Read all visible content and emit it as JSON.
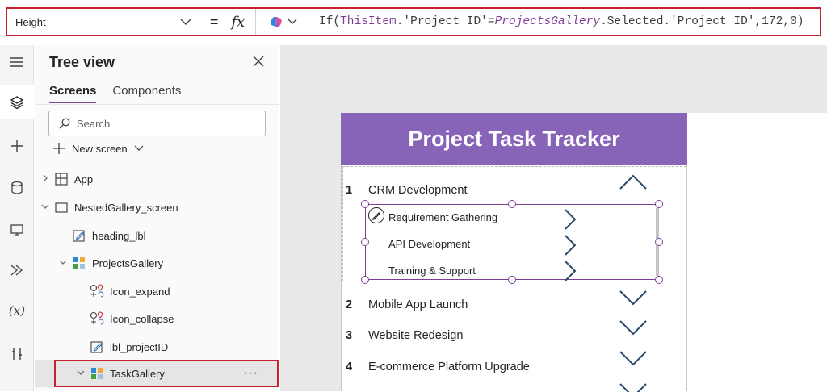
{
  "formula_bar": {
    "property": "Height",
    "equals": "=",
    "fx": "fx",
    "formula_parts": {
      "f1": "If(",
      "f2": "ThisItem",
      "f3": ".'Project ID'=",
      "f4": "ProjectsGallery",
      "f5": ".Selected.'Project ID',172,0)"
    }
  },
  "tree": {
    "title": "Tree view",
    "tabs": [
      "Screens",
      "Components"
    ],
    "search_placeholder": "Search",
    "new_screen": "New screen",
    "items": [
      {
        "label": "App"
      },
      {
        "label": "NestedGallery_screen"
      },
      {
        "label": "heading_lbl"
      },
      {
        "label": "ProjectsGallery"
      },
      {
        "label": "Icon_expand"
      },
      {
        "label": "Icon_collapse"
      },
      {
        "label": "lbl_projectID"
      },
      {
        "label": "TaskGallery"
      }
    ],
    "more": "···"
  },
  "app": {
    "title": "Project Task Tracker",
    "projects": [
      {
        "num": "1",
        "name": "CRM Development"
      },
      {
        "num": "2",
        "name": "Mobile App Launch"
      },
      {
        "num": "3",
        "name": "Website Redesign"
      },
      {
        "num": "4",
        "name": "E-commerce Platform Upgrade"
      }
    ],
    "tasks": [
      "Requirement Gathering",
      "API Development",
      "Training & Support"
    ]
  },
  "colors": {
    "accent": "#8764b8",
    "highlight": "#c8202f"
  }
}
